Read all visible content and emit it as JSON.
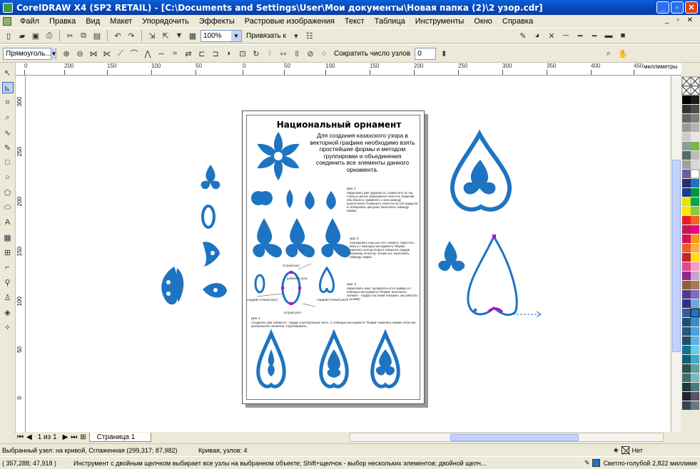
{
  "window": {
    "title": "CorelDRAW X4 (SP2 RETAIL) - [C:\\Documents and Settings\\User\\Мои документы\\Новая папка (2)\\2 узор.cdr]",
    "controls": [
      "_",
      "▫",
      "✕"
    ]
  },
  "menu": {
    "items": [
      "Файл",
      "Правка",
      "Вид",
      "Макет",
      "Упорядочить",
      "Эффекты",
      "Растровые изображения",
      "Текст",
      "Таблица",
      "Инструменты",
      "Окно",
      "Справка"
    ],
    "mdi_controls": "_ ▫ ✕"
  },
  "toolbar_standard": {
    "zoom": "100%",
    "snap_label": "Привязать к"
  },
  "property_bar": {
    "object_type": "Прямоуголь...",
    "reduce_nodes_label": "Сократить число узлов",
    "reduce_nodes_value": "0"
  },
  "ruler": {
    "units": "миллиметры",
    "h_ticks": [
      "0",
      "200",
      "150",
      "100",
      "50",
      "0",
      "50",
      "100",
      "150",
      "200",
      "250",
      "300",
      "350",
      "400",
      "450"
    ],
    "v_ticks": [
      "300",
      "250",
      "200",
      "150",
      "100",
      "50",
      "0"
    ]
  },
  "document": {
    "title": "Национальный орнамент",
    "intro": "Для создания казахского узора в векторной графике необходимо взять простейшие формы и методом группировки и объединения соединить все элементы данного орнамента.",
    "step1_head": "Шаг 1",
    "step1_text": "Нарисовать две окружности, совместить их так, чтобы в центре образовался лепесток. Выделив оба объекта, применить к ним команду пересечения. Повернуть лепесток на 120 градусов и скопировать два раза. Выполнить команду сварка.",
    "step2_head": "Шаг 2",
    "step2_text": "Скопировать еще раз этот элемент, поместить вниз и с помощью инструмента \"Форма\" изменить контур второго элемента, придав верхнему лепестку точную ось. Выполнить команду сварка.",
    "step3_head": "Шаг 3",
    "step3_text": "Нарисовать овал, превратить его в кривую и с помощью инструмента \"Форма\" выполнить элемент - сердце (на схеме показано, как работать с узлами)",
    "step4_head": "Шаг 4",
    "step4_text": "Соединить два элемента - сердце в центральную часть. С помощью инструмента \"Форма\" изменить нижние лепестки центрального элемента. Сгруппировать.",
    "node_labels": [
      "острый узел",
      "добавить узлы",
      "гладкий (точный узел)",
      "острый узел",
      "гладкий (точный узел)"
    ]
  },
  "page_nav": {
    "position": "1 из 1",
    "tab": "Страница 1"
  },
  "status": {
    "selected_node": "Выбранный узел: на кривой, Сглаженная (299,317; 87,982)",
    "object_info": "Кривая, узлов: 4",
    "fill_label": "Нет",
    "coords": "( 357,288; 47,918 )",
    "hint": "Инструмент с двойным щелчком выбирает все узлы на выбранном объекте; Shift+щелчок - выбор нескольких элементов; двойной щелч...",
    "outline_label": "Светло-голубой  2,822 миллиме"
  },
  "colors": {
    "ornament": "#1e74c0",
    "selection": "#c000c0"
  }
}
